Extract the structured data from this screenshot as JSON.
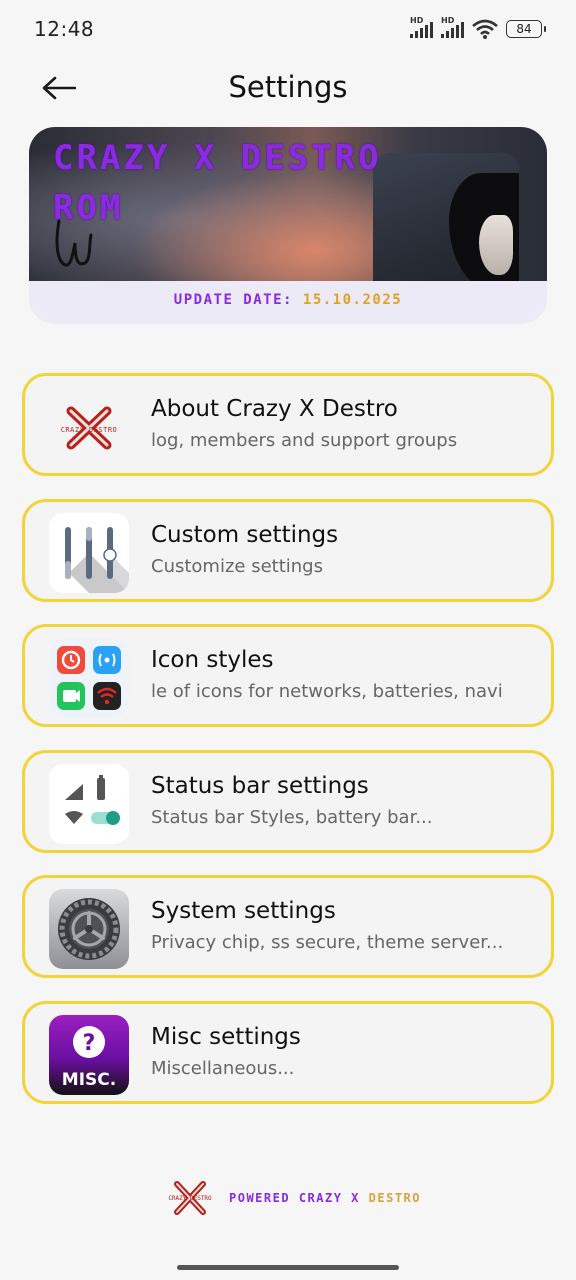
{
  "status_bar": {
    "time": "12:48",
    "net1_label": "HD",
    "net2_label": "HD",
    "battery": "84"
  },
  "header": {
    "title": "Settings",
    "back_icon": "arrow-left-icon"
  },
  "banner": {
    "rom_title": "CRAZY X DESTRO ROM",
    "update_label": "UPDATE DATE:",
    "update_date": "15.10.2025",
    "colors": {
      "title": "#8a2be2",
      "date": "#e0a320"
    }
  },
  "menu": {
    "items": [
      {
        "title": "About Crazy X Destro",
        "subtitle": "log, members and support groups",
        "icon": "crazy-x-destro-logo-icon"
      },
      {
        "title": "Custom settings",
        "subtitle": "Customize settings",
        "icon": "sliders-icon"
      },
      {
        "title": "Icon styles",
        "subtitle": "le of icons for networks, batteries, navi",
        "icon": "icon-styles-grid-icon"
      },
      {
        "title": "Status bar settings",
        "subtitle": "Status bar Styles, battery bar...",
        "icon": "status-bar-icon"
      },
      {
        "title": "System settings",
        "subtitle": "Privacy chip, ss secure, theme server...",
        "icon": "gear-icon"
      },
      {
        "title": "Misc settings",
        "subtitle": "Miscellaneous...",
        "icon": "misc-icon",
        "icon_text": "MISC."
      }
    ],
    "border_color": "#f2d43a"
  },
  "footer": {
    "powered": "POWERED",
    "crazy": "CRAZY",
    "x": "X",
    "destro": "DESTRO"
  }
}
